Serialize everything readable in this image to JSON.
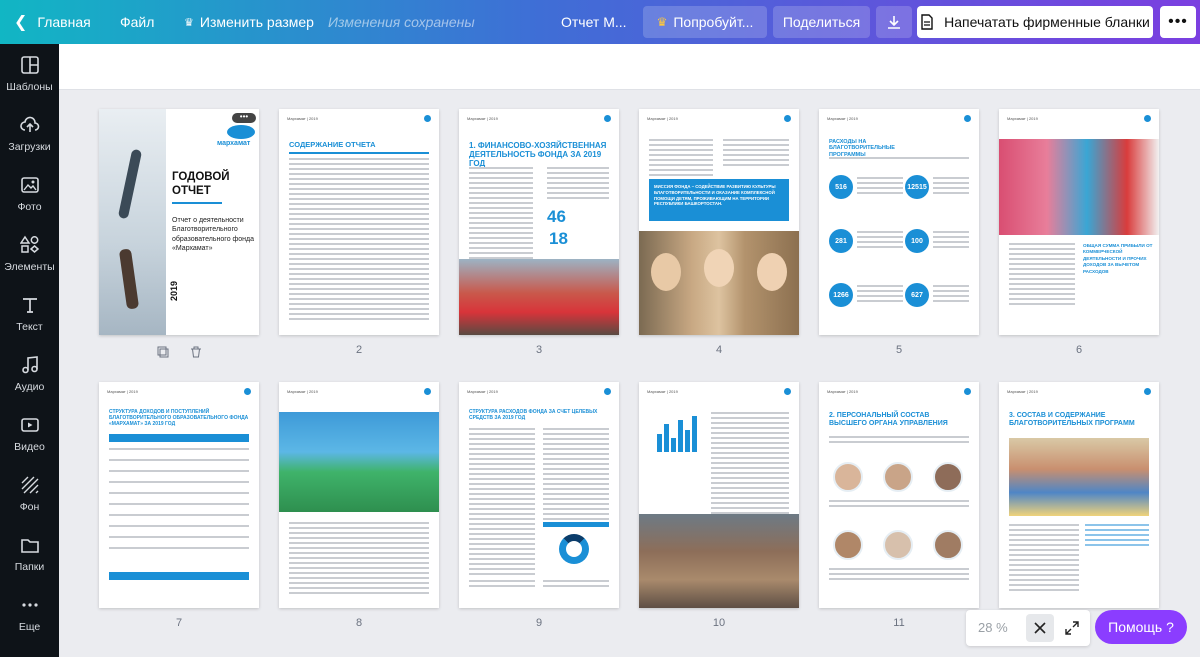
{
  "topbar": {
    "home": "Главная",
    "file": "Файл",
    "resize": "Изменить размер",
    "saved": "Изменения сохранены",
    "doc_title": "Отчет М...",
    "try": "Попробуйт...",
    "share": "Поделиться",
    "print": "Напечатать фирменные бланки"
  },
  "sidebar": [
    {
      "label": "Шаблоны",
      "icon": "templates-icon"
    },
    {
      "label": "Загрузки",
      "icon": "upload-icon"
    },
    {
      "label": "Фото",
      "icon": "photo-icon"
    },
    {
      "label": "Элементы",
      "icon": "elements-icon"
    },
    {
      "label": "Текст",
      "icon": "text-icon"
    },
    {
      "label": "Аудио",
      "icon": "audio-icon"
    },
    {
      "label": "Видео",
      "icon": "video-icon"
    },
    {
      "label": "Фон",
      "icon": "background-icon"
    },
    {
      "label": "Папки",
      "icon": "folder-icon"
    },
    {
      "label": "Еще",
      "icon": "more-icon"
    }
  ],
  "pages": [
    {
      "num": "",
      "title": "ГОДОВОЙ ОТЧЕТ",
      "subtitle": "Отчет о деятельности Благотворительного образовательного фонда «Мархамат»",
      "year": "2019",
      "logo": "мархамат"
    },
    {
      "num": "2",
      "title": "СОДЕРЖАНИЕ ОТЧЕТА"
    },
    {
      "num": "3",
      "title": "1. ФИНАНСОВО-ХОЗЯЙСТВЕННАЯ ДЕЯТЕЛЬНОСТЬ ФОНДА ЗА 2019 ГОД",
      "big1": "46",
      "big2": "18"
    },
    {
      "num": "4",
      "mission": "МИССИЯ ФОНДА – СОДЕЙСТВИЕ РАЗВИТИЮ КУЛЬТУРЫ БЛАГОТВОРИТЕЛЬНОСТИ И ОКАЗАНИЕ КОМПЛЕКСНОЙ ПОМОЩИ ДЕТЯМ, ПРОЖИВАЮЩИМ НА ТЕРРИТОРИИ РЕСПУБЛИКИ БАШКОРТОСТАН."
    },
    {
      "num": "5",
      "title": "РАСХОДЫ НА БЛАГОТВОРИТЕЛЬНЫЕ ПРОГРАММЫ",
      "stats": [
        "516",
        "12515",
        "281",
        "100",
        "1266",
        "627"
      ],
      "unit": "тыс."
    },
    {
      "num": "6",
      "note": "ОБЩАЯ СУММА ПРИБЫЛИ ОТ КОММЕРЧЕСКОЙ ДЕЯТЕЛЬНОСТИ И ПРОЧИХ ДОХОДОВ ЗА ВЫЧЕТОМ РАСХОДОВ"
    },
    {
      "num": "7",
      "title": "СТРУКТУРА ДОХОДОВ И ПОСТУПЛЕНИЙ БЛАГОТВОРИТЕЛЬНОГО ОБРАЗОВАТЕЛЬНОГО ФОНДА «МАРХАМАТ» ЗА 2019 ГОД"
    },
    {
      "num": "8"
    },
    {
      "num": "9",
      "title": "СТРУКТУРА РАСХОДОВ ФОНДА ЗА СЧЕТ ЦЕЛЕВЫХ СРЕДСТВ ЗА 2019 ГОД"
    },
    {
      "num": "10"
    },
    {
      "num": "11",
      "title": "2. ПЕРСОНАЛЬНЫЙ СОСТАВ ВЫСШЕГО ОРГАНА УПРАВЛЕНИЯ"
    },
    {
      "num": "",
      "title": "3. СОСТАВ И СОДЕРЖАНИЕ БЛАГОТВОРИТЕЛЬНЫХ ПРОГРАММ"
    }
  ],
  "zoom": "28 %",
  "help": "Помощь ?",
  "colors": {
    "accent": "#1a8fd6",
    "sidebar": "#0e1318",
    "help": "#8b3dff"
  }
}
